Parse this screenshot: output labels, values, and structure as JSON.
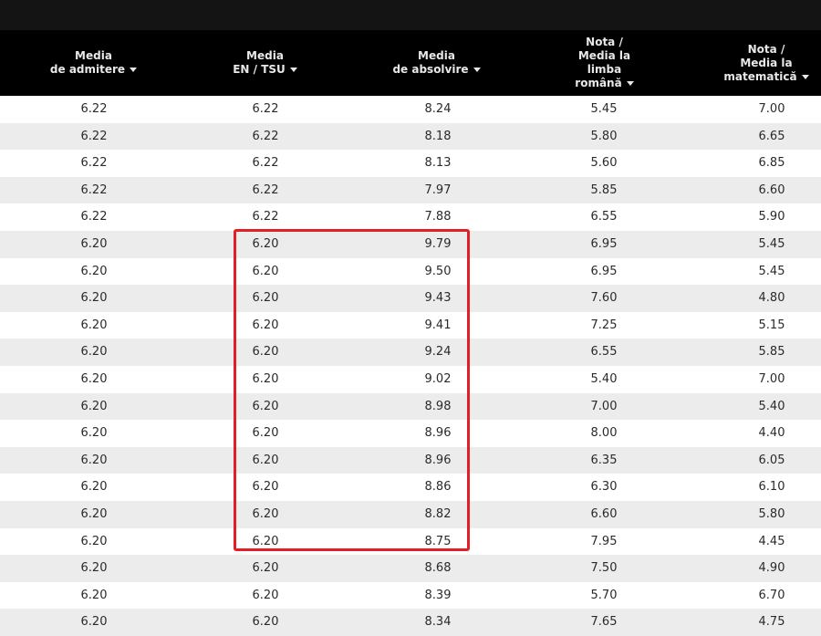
{
  "header": {
    "columns": [
      {
        "line1": "Media",
        "line2": "de admitere"
      },
      {
        "line1": "Media",
        "line2": "EN / TSU"
      },
      {
        "line1": "Media",
        "line2": "de absolvire"
      },
      {
        "line1": "Nota /",
        "line2": "Media la",
        "line3": "limba",
        "line4": "română"
      },
      {
        "line1": "Nota /",
        "line2": "Media la",
        "line3": "matematică"
      }
    ]
  },
  "colors": {
    "header_bg": "#000000",
    "topbar_bg": "#141414",
    "row_alt_bg": "#ececec",
    "highlight_border": "#e31e24"
  },
  "table": {
    "rows": [
      [
        "6.22",
        "6.22",
        "8.24",
        "5.45",
        "7.00"
      ],
      [
        "6.22",
        "6.22",
        "8.18",
        "5.80",
        "6.65"
      ],
      [
        "6.22",
        "6.22",
        "8.13",
        "5.60",
        "6.85"
      ],
      [
        "6.22",
        "6.22",
        "7.97",
        "5.85",
        "6.60"
      ],
      [
        "6.22",
        "6.22",
        "7.88",
        "6.55",
        "5.90"
      ],
      [
        "6.20",
        "6.20",
        "9.79",
        "6.95",
        "5.45"
      ],
      [
        "6.20",
        "6.20",
        "9.50",
        "6.95",
        "5.45"
      ],
      [
        "6.20",
        "6.20",
        "9.43",
        "7.60",
        "4.80"
      ],
      [
        "6.20",
        "6.20",
        "9.41",
        "7.25",
        "5.15"
      ],
      [
        "6.20",
        "6.20",
        "9.24",
        "6.55",
        "5.85"
      ],
      [
        "6.20",
        "6.20",
        "9.02",
        "5.40",
        "7.00"
      ],
      [
        "6.20",
        "6.20",
        "8.98",
        "7.00",
        "5.40"
      ],
      [
        "6.20",
        "6.20",
        "8.96",
        "8.00",
        "4.40"
      ],
      [
        "6.20",
        "6.20",
        "8.96",
        "6.35",
        "6.05"
      ],
      [
        "6.20",
        "6.20",
        "8.86",
        "6.30",
        "6.10"
      ],
      [
        "6.20",
        "6.20",
        "8.82",
        "6.60",
        "5.80"
      ],
      [
        "6.20",
        "6.20",
        "8.75",
        "7.95",
        "4.45"
      ],
      [
        "6.20",
        "6.20",
        "8.68",
        "7.50",
        "4.90"
      ],
      [
        "6.20",
        "6.20",
        "8.39",
        "5.70",
        "6.70"
      ],
      [
        "6.20",
        "6.20",
        "8.34",
        "7.65",
        "4.75"
      ]
    ]
  }
}
